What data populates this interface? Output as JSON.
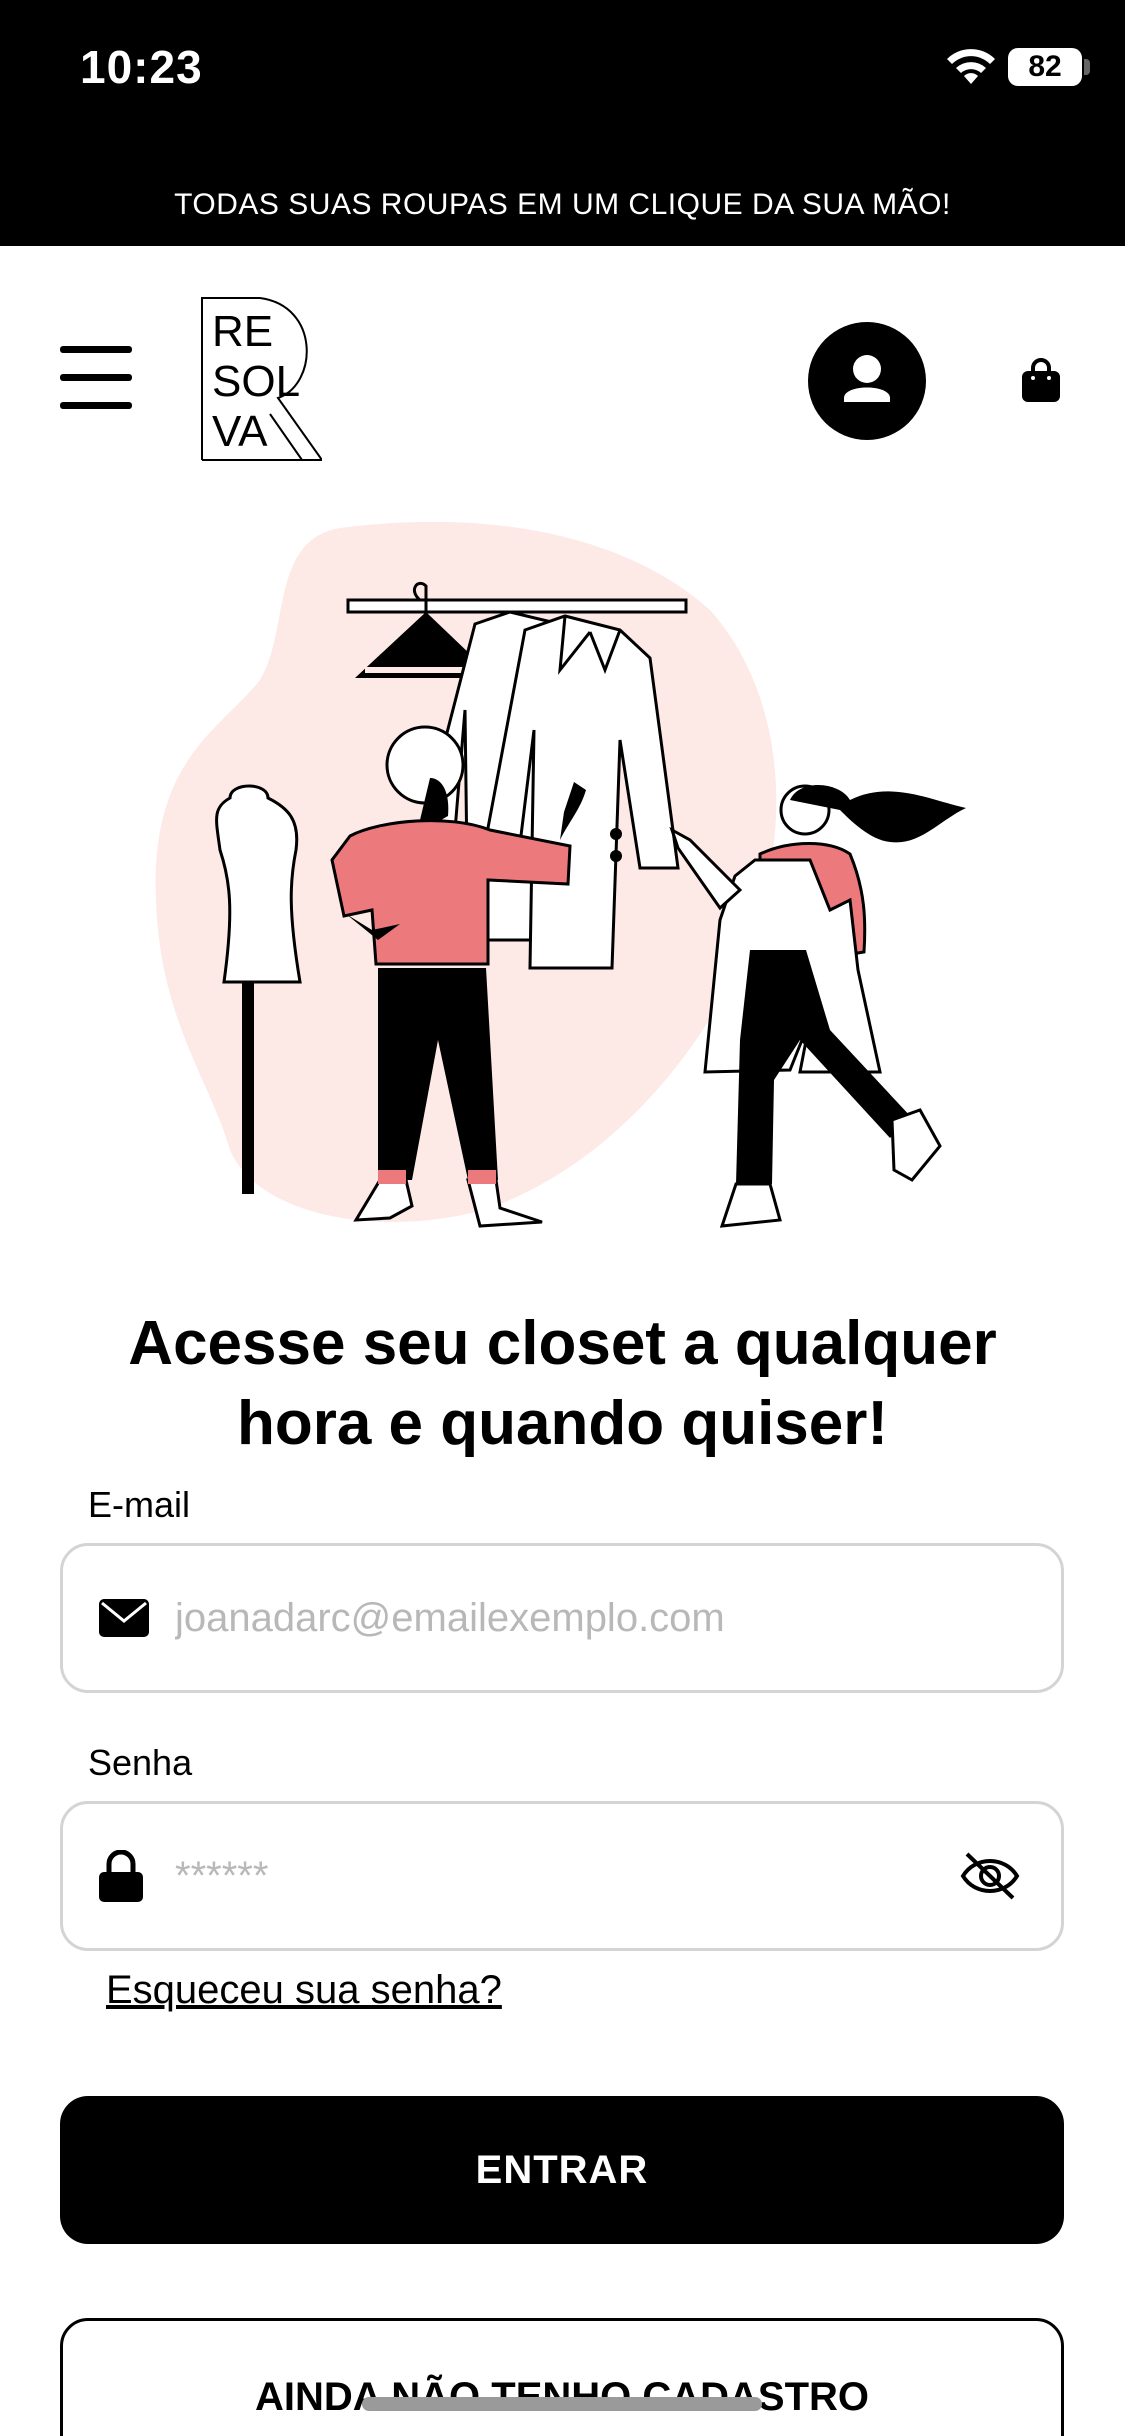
{
  "status_bar": {
    "time": "10:23",
    "battery": "82"
  },
  "promo_banner": {
    "text": "TODAS SUAS ROUPAS EM UM CLIQUE DA SUA MÃO!"
  },
  "header": {
    "logo_text": [
      "RE",
      "SOL",
      "VA"
    ]
  },
  "login": {
    "heading_line1": "Acesse seu closet a qualquer",
    "heading_line2": "hora e quando quiser!",
    "email_label": "E-mail",
    "email_placeholder": "joanadarc@emailexemplo.com",
    "password_label": "Senha",
    "password_placeholder": "******",
    "forgot_link": "Esqueceu sua senha?",
    "submit_label": "ENTRAR",
    "register_label": "AINDA NÃO TENHO CADASTRO"
  },
  "colors": {
    "accent_pink": "#ec7a7c",
    "blob_pink": "#fde9e6",
    "black": "#000000",
    "border_grey": "#d4d4d4"
  },
  "icons": [
    "wifi-icon",
    "battery-icon",
    "hamburger-menu-icon",
    "user-icon",
    "shopping-bag-icon",
    "envelope-icon",
    "lock-icon",
    "eye-off-icon"
  ]
}
